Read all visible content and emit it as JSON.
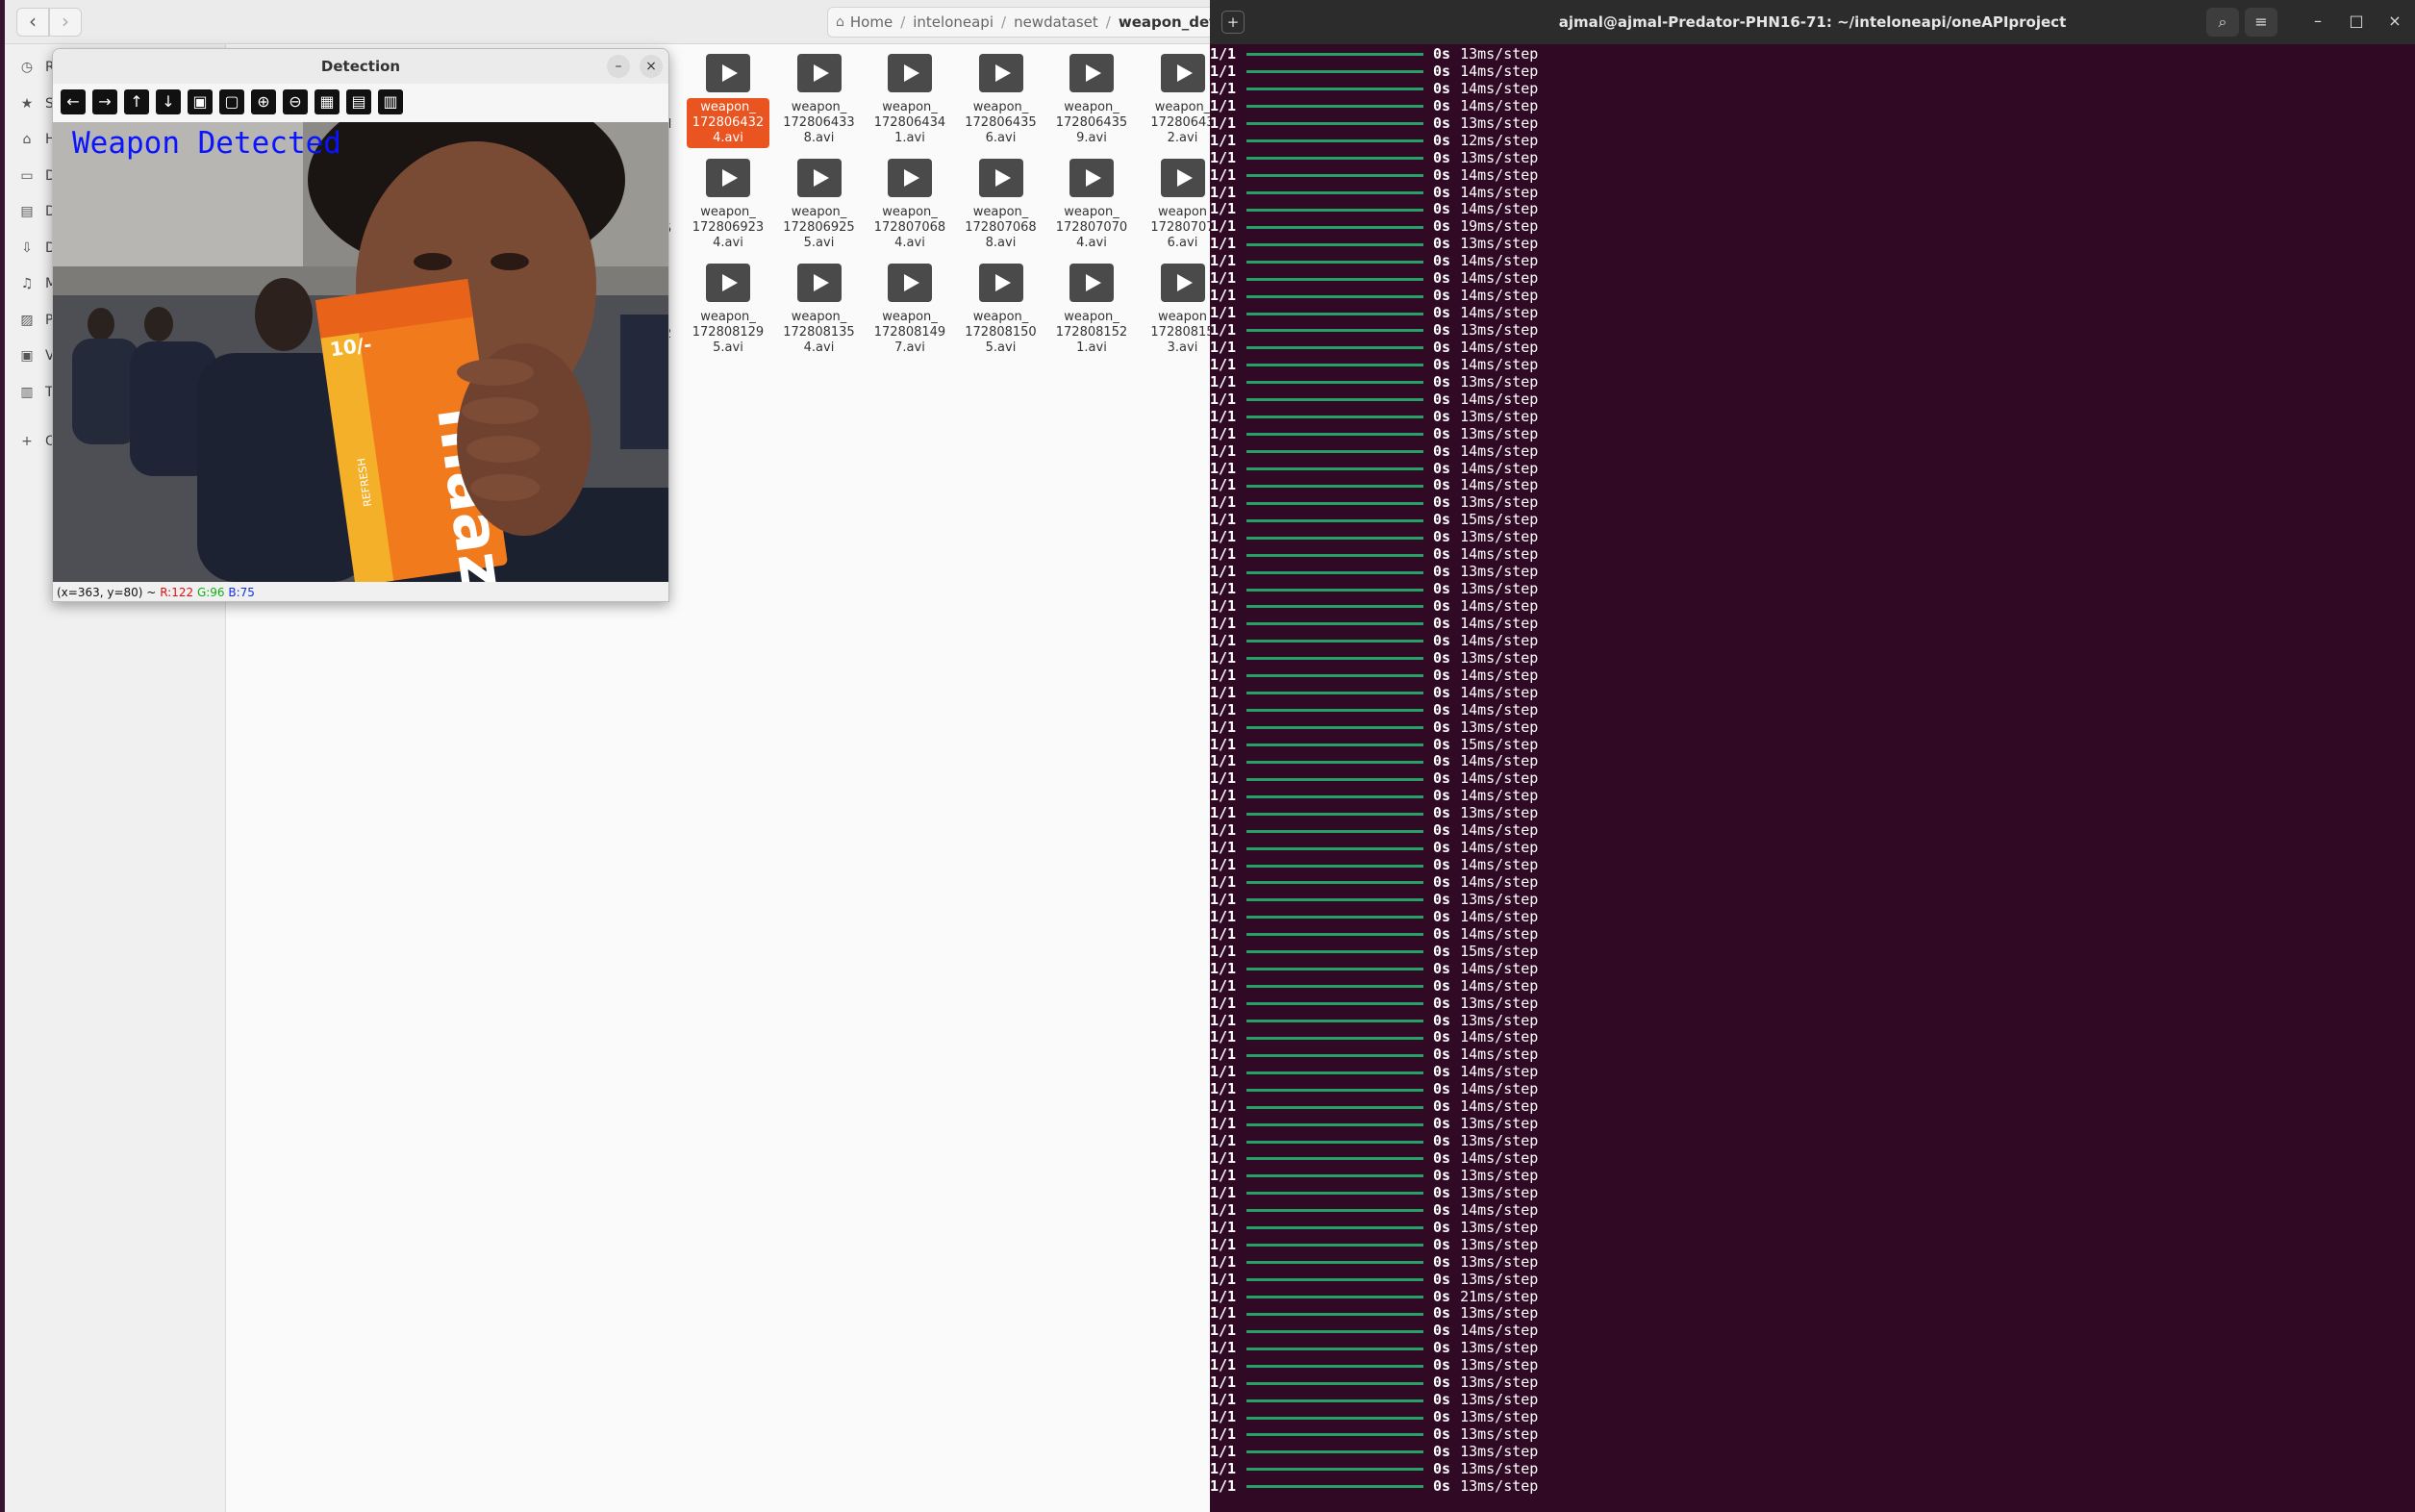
{
  "file_manager": {
    "path": {
      "home": "Home",
      "segments": [
        "inteloneapi",
        "newdataset"
      ],
      "current": "weapon_dete"
    },
    "sidebar": [
      {
        "icon": "clock-icon",
        "label": "Re"
      },
      {
        "icon": "star-icon",
        "label": "St"
      },
      {
        "icon": "home-icon",
        "label": "H"
      },
      {
        "icon": "desktop-icon",
        "label": "D"
      },
      {
        "icon": "document-icon",
        "label": "D"
      },
      {
        "icon": "download-icon",
        "label": "D"
      },
      {
        "icon": "music-icon",
        "label": "M"
      },
      {
        "icon": "pictures-icon",
        "label": "Pi"
      },
      {
        "icon": "videos-icon",
        "label": "V"
      },
      {
        "icon": "trash-icon",
        "label": "Tr"
      },
      {
        "icon": "plus-icon",
        "label": "O"
      }
    ],
    "files": [
      {
        "name": "weapon_\n172806432\n4.avi",
        "selected": true
      },
      {
        "name": "weapon_\n172806433\n8.avi"
      },
      {
        "name": "weapon_\n172806434\n1.avi"
      },
      {
        "name": "weapon_\n172806435\n6.avi"
      },
      {
        "name": "weapon_\n172806435\n9.avi"
      },
      {
        "name": "weapon_\n17280643\n2.avi"
      },
      {
        "name": "weapon_\n172806923\n4.avi"
      },
      {
        "name": "weapon_\n172806925\n5.avi"
      },
      {
        "name": "weapon_\n172807068\n4.avi"
      },
      {
        "name": "weapon_\n172807068\n8.avi"
      },
      {
        "name": "weapon_\n172807070\n4.avi"
      },
      {
        "name": "weapon\n17280707\n6.avi"
      },
      {
        "name": "weapon_\n172808129\n5.avi"
      },
      {
        "name": "weapon_\n172808135\n4.avi"
      },
      {
        "name": "weapon_\n172808149\n7.avi"
      },
      {
        "name": "weapon_\n172808150\n5.avi"
      },
      {
        "name": "weapon_\n172808152\n1.avi"
      },
      {
        "name": "weapon\n17280815\n3.avi"
      }
    ],
    "edge_fragments": [
      "d",
      "5",
      "2"
    ]
  },
  "detection_window": {
    "title": "Detection",
    "overlay_text": "Weapon Detected",
    "toolbar": [
      "arrow-left-icon",
      "arrow-right-icon",
      "arrow-up-icon",
      "arrow-down-icon",
      "zoom-fit-icon",
      "zoom-actual-icon",
      "zoom-in-icon",
      "zoom-out-icon",
      "save-icon",
      "copy-icon",
      "properties-icon"
    ],
    "status": {
      "coords": "(x=363, y=80) ~",
      "r": "R:122",
      "g": "G:96",
      "b": "B:75"
    },
    "package_text": {
      "brand": "maaza",
      "price": "10/-",
      "tag": "REFRESH"
    }
  },
  "terminal": {
    "title": "ajmal@ajmal-Predator-PHN16-71: ~/inteloneapi/oneAPIproject",
    "lines": [
      [
        "1/1",
        "0s",
        "13ms/step"
      ],
      [
        "1/1",
        "0s",
        "14ms/step"
      ],
      [
        "1/1",
        "0s",
        "14ms/step"
      ],
      [
        "1/1",
        "0s",
        "14ms/step"
      ],
      [
        "1/1",
        "0s",
        "13ms/step"
      ],
      [
        "1/1",
        "0s",
        "12ms/step"
      ],
      [
        "1/1",
        "0s",
        "13ms/step"
      ],
      [
        "1/1",
        "0s",
        "14ms/step"
      ],
      [
        "1/1",
        "0s",
        "14ms/step"
      ],
      [
        "1/1",
        "0s",
        "14ms/step"
      ],
      [
        "1/1",
        "0s",
        "19ms/step"
      ],
      [
        "1/1",
        "0s",
        "13ms/step"
      ],
      [
        "1/1",
        "0s",
        "14ms/step"
      ],
      [
        "1/1",
        "0s",
        "14ms/step"
      ],
      [
        "1/1",
        "0s",
        "14ms/step"
      ],
      [
        "1/1",
        "0s",
        "14ms/step"
      ],
      [
        "1/1",
        "0s",
        "13ms/step"
      ],
      [
        "1/1",
        "0s",
        "14ms/step"
      ],
      [
        "1/1",
        "0s",
        "14ms/step"
      ],
      [
        "1/1",
        "0s",
        "13ms/step"
      ],
      [
        "1/1",
        "0s",
        "14ms/step"
      ],
      [
        "1/1",
        "0s",
        "13ms/step"
      ],
      [
        "1/1",
        "0s",
        "13ms/step"
      ],
      [
        "1/1",
        "0s",
        "14ms/step"
      ],
      [
        "1/1",
        "0s",
        "14ms/step"
      ],
      [
        "1/1",
        "0s",
        "14ms/step"
      ],
      [
        "1/1",
        "0s",
        "13ms/step"
      ],
      [
        "1/1",
        "0s",
        "15ms/step"
      ],
      [
        "1/1",
        "0s",
        "13ms/step"
      ],
      [
        "1/1",
        "0s",
        "14ms/step"
      ],
      [
        "1/1",
        "0s",
        "13ms/step"
      ],
      [
        "1/1",
        "0s",
        "13ms/step"
      ],
      [
        "1/1",
        "0s",
        "14ms/step"
      ],
      [
        "1/1",
        "0s",
        "14ms/step"
      ],
      [
        "1/1",
        "0s",
        "14ms/step"
      ],
      [
        "1/1",
        "0s",
        "13ms/step"
      ],
      [
        "1/1",
        "0s",
        "14ms/step"
      ],
      [
        "1/1",
        "0s",
        "14ms/step"
      ],
      [
        "1/1",
        "0s",
        "14ms/step"
      ],
      [
        "1/1",
        "0s",
        "13ms/step"
      ],
      [
        "1/1",
        "0s",
        "15ms/step"
      ],
      [
        "1/1",
        "0s",
        "14ms/step"
      ],
      [
        "1/1",
        "0s",
        "14ms/step"
      ],
      [
        "1/1",
        "0s",
        "14ms/step"
      ],
      [
        "1/1",
        "0s",
        "13ms/step"
      ],
      [
        "1/1",
        "0s",
        "14ms/step"
      ],
      [
        "1/1",
        "0s",
        "14ms/step"
      ],
      [
        "1/1",
        "0s",
        "14ms/step"
      ],
      [
        "1/1",
        "0s",
        "14ms/step"
      ],
      [
        "1/1",
        "0s",
        "13ms/step"
      ],
      [
        "1/1",
        "0s",
        "14ms/step"
      ],
      [
        "1/1",
        "0s",
        "14ms/step"
      ],
      [
        "1/1",
        "0s",
        "15ms/step"
      ],
      [
        "1/1",
        "0s",
        "14ms/step"
      ],
      [
        "1/1",
        "0s",
        "14ms/step"
      ],
      [
        "1/1",
        "0s",
        "13ms/step"
      ],
      [
        "1/1",
        "0s",
        "13ms/step"
      ],
      [
        "1/1",
        "0s",
        "14ms/step"
      ],
      [
        "1/1",
        "0s",
        "14ms/step"
      ],
      [
        "1/1",
        "0s",
        "14ms/step"
      ],
      [
        "1/1",
        "0s",
        "14ms/step"
      ],
      [
        "1/1",
        "0s",
        "14ms/step"
      ],
      [
        "1/1",
        "0s",
        "13ms/step"
      ],
      [
        "1/1",
        "0s",
        "13ms/step"
      ],
      [
        "1/1",
        "0s",
        "14ms/step"
      ],
      [
        "1/1",
        "0s",
        "13ms/step"
      ],
      [
        "1/1",
        "0s",
        "13ms/step"
      ],
      [
        "1/1",
        "0s",
        "14ms/step"
      ],
      [
        "1/1",
        "0s",
        "13ms/step"
      ],
      [
        "1/1",
        "0s",
        "13ms/step"
      ],
      [
        "1/1",
        "0s",
        "13ms/step"
      ],
      [
        "1/1",
        "0s",
        "13ms/step"
      ],
      [
        "1/1",
        "0s",
        "21ms/step"
      ],
      [
        "1/1",
        "0s",
        "13ms/step"
      ],
      [
        "1/1",
        "0s",
        "14ms/step"
      ],
      [
        "1/1",
        "0s",
        "13ms/step"
      ],
      [
        "1/1",
        "0s",
        "13ms/step"
      ],
      [
        "1/1",
        "0s",
        "13ms/step"
      ],
      [
        "1/1",
        "0s",
        "13ms/step"
      ],
      [
        "1/1",
        "0s",
        "13ms/step"
      ],
      [
        "1/1",
        "0s",
        "13ms/step"
      ],
      [
        "1/1",
        "0s",
        "13ms/step"
      ],
      [
        "1/1",
        "0s",
        "13ms/step"
      ],
      [
        "1/1",
        "0s",
        "13ms/step"
      ]
    ]
  },
  "colors": {
    "terminal_bg": "#300a24",
    "progress_bar": "#26a269",
    "selected_file": "#e95420",
    "overlay_text": "#0a14ff"
  }
}
